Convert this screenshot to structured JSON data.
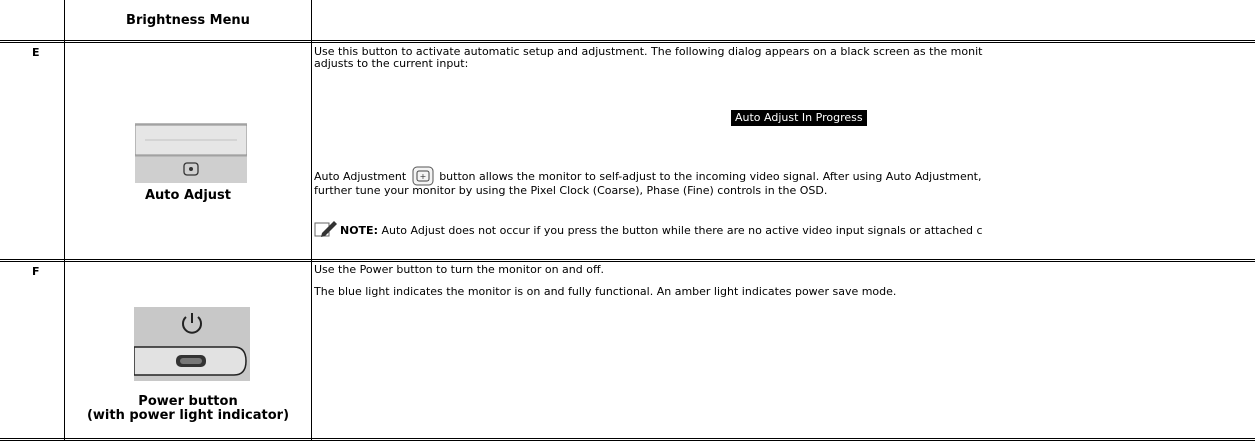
{
  "row_top": {
    "caption": "Brightness Menu"
  },
  "row_e": {
    "letter": "E",
    "caption": "Auto Adjust",
    "para1_line1": "Use this button to activate automatic setup and adjustment. The following dialog appears on a black screen as the monit",
    "para1_line2": "adjusts to the current input:",
    "banner": "Auto Adjust In Progress",
    "para2_before_icon": "Auto Adjustment",
    "para2_after_icon": "button allows the monitor to self-adjust to the incoming video signal. After using Auto Adjustment,",
    "para2_line2": "further tune your monitor by using the Pixel Clock (Coarse), Phase (Fine) controls in the OSD.",
    "note_label": "NOTE:",
    "note_text": " Auto Adjust does not occur if you press the button while there are no active video input signals or attached c",
    "icons": {
      "button_icon": "auto-adjust-icon",
      "note_icon": "note-pencil-icon"
    }
  },
  "row_f": {
    "letter": "F",
    "caption_line1": "Power button",
    "caption_line2": "(with power light indicator)",
    "para1": "Use the Power button to turn the monitor on and off.",
    "para2": "The blue light indicates the monitor is on and fully functional. An amber light indicates power save mode.",
    "icons": {
      "power_icon": "power-icon"
    }
  },
  "colors": {
    "border": "#000000",
    "banner_bg": "#000000",
    "banner_text": "#ffffff",
    "panel_gray": "#c8c8c8"
  }
}
